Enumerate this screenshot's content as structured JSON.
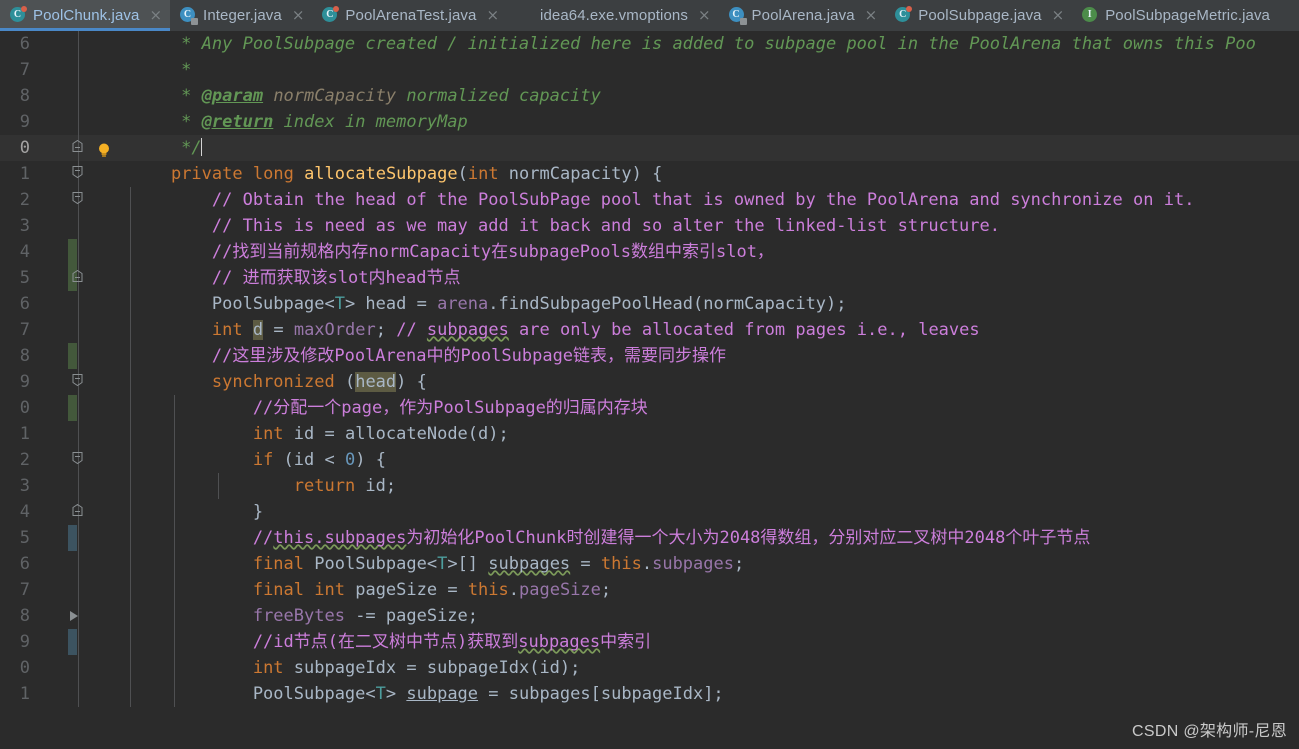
{
  "window": {
    "app": "IntelliJ IDEA",
    "theme_bg": "#2b2b2b",
    "accent": "#4a88c7"
  },
  "tabbar": {
    "tabs": [
      {
        "label": "PoolChunk.java",
        "icon": "java-class-icon",
        "icon_kind": "class-teal-dot",
        "active": true,
        "close": "×"
      },
      {
        "label": "Integer.java",
        "icon": "java-class-lock-icon",
        "icon_kind": "class-lock",
        "active": false,
        "close": "×"
      },
      {
        "label": "PoolArenaTest.java",
        "icon": "java-class-test-icon",
        "icon_kind": "class-teal-dot",
        "active": false,
        "close": "×"
      },
      {
        "label": "idea64.exe.vmoptions",
        "icon": "text-file-icon",
        "icon_kind": "file",
        "active": false,
        "close": "×"
      },
      {
        "label": "PoolArena.java",
        "icon": "java-class-abstract-icon",
        "icon_kind": "class-lock",
        "active": false,
        "close": "×"
      },
      {
        "label": "PoolSubpage.java",
        "icon": "java-class-icon",
        "icon_kind": "class-teal-dot",
        "active": false,
        "close": "×"
      },
      {
        "label": "PoolSubpageMetric.java",
        "icon": "java-interface-icon",
        "icon_kind": "interface",
        "active": false,
        "close": ""
      }
    ]
  },
  "editor": {
    "language": "Java",
    "lines": [
      {
        "num": "6",
        "vcs": "",
        "fold": "",
        "bulb": false,
        "current": false,
        "indents": [],
        "tokens": [
          {
            "t": "     * Any PoolSubpage created / initialized here is added to subpage pool in the PoolArena that owns this Poo",
            "c": "c-doc"
          }
        ]
      },
      {
        "num": "7",
        "vcs": "",
        "fold": "",
        "bulb": false,
        "current": false,
        "indents": [],
        "tokens": [
          {
            "t": "     *",
            "c": "c-doc"
          }
        ]
      },
      {
        "num": "8",
        "vcs": "",
        "fold": "",
        "bulb": false,
        "current": false,
        "indents": [],
        "tokens": [
          {
            "t": "     * ",
            "c": "c-doc"
          },
          {
            "t": "@param",
            "c": "c-doctag"
          },
          {
            "t": " normCapacity",
            "c": "c-docval"
          },
          {
            "t": " normalized capacity",
            "c": "c-doc"
          }
        ]
      },
      {
        "num": "9",
        "vcs": "",
        "fold": "",
        "bulb": false,
        "current": false,
        "indents": [],
        "tokens": [
          {
            "t": "     * ",
            "c": "c-doc"
          },
          {
            "t": "@return",
            "c": "c-doctag"
          },
          {
            "t": " index in memoryMap",
            "c": "c-doc"
          }
        ]
      },
      {
        "num": "0",
        "vcs": "",
        "fold": "end",
        "bulb": true,
        "current": true,
        "indents": [],
        "tokens": [
          {
            "t": "     */",
            "c": "c-doc"
          },
          {
            "t": "",
            "c": "caret"
          }
        ]
      },
      {
        "num": "1",
        "vcs": "",
        "fold": "start",
        "bulb": false,
        "current": false,
        "indents": [],
        "tokens": [
          {
            "t": "    ",
            "c": "c-punc"
          },
          {
            "t": "private",
            "c": "c-kw"
          },
          {
            "t": " ",
            "c": "c-punc"
          },
          {
            "t": "long",
            "c": "c-kw"
          },
          {
            "t": " ",
            "c": "c-punc"
          },
          {
            "t": "allocateSubpage",
            "c": "c-method"
          },
          {
            "t": "(",
            "c": "c-punc"
          },
          {
            "t": "int",
            "c": "c-kw"
          },
          {
            "t": " normCapacity) {",
            "c": "c-punc"
          }
        ]
      },
      {
        "num": "2",
        "vcs": "",
        "fold": "start",
        "bulb": false,
        "current": false,
        "indents": [
          130
        ],
        "tokens": [
          {
            "t": "        // Obtain the head of the PoolSubPage pool that is owned by the PoolArena and synchronize on it.",
            "c": "c-comment"
          }
        ]
      },
      {
        "num": "3",
        "vcs": "",
        "fold": "",
        "bulb": false,
        "current": false,
        "indents": [
          130
        ],
        "tokens": [
          {
            "t": "        // This is need as we may add it back and so alter the linked-list structure.",
            "c": "c-comment"
          }
        ]
      },
      {
        "num": "4",
        "vcs": "green",
        "fold": "",
        "bulb": false,
        "current": false,
        "indents": [
          130
        ],
        "tokens": [
          {
            "t": "        //找到当前规格内存normCapacity在subpagePools数组中索引slot，",
            "c": "c-comment"
          }
        ]
      },
      {
        "num": "5",
        "vcs": "green",
        "fold": "end",
        "bulb": false,
        "current": false,
        "indents": [
          130
        ],
        "tokens": [
          {
            "t": "        // 进而获取该slot内head节点",
            "c": "c-comment"
          }
        ]
      },
      {
        "num": "6",
        "vcs": "",
        "fold": "",
        "bulb": false,
        "current": false,
        "indents": [
          130
        ],
        "tokens": [
          {
            "t": "        PoolSubpage<",
            "c": "c-type"
          },
          {
            "t": "T",
            "c": "c-gen"
          },
          {
            "t": "> head = ",
            "c": "c-type"
          },
          {
            "t": "arena",
            "c": "c-field"
          },
          {
            "t": ".",
            "c": "c-punc"
          },
          {
            "t": "findSubpagePoolHead",
            "c": "c-ident"
          },
          {
            "t": "(normCapacity);",
            "c": "c-punc"
          }
        ]
      },
      {
        "num": "7",
        "vcs": "",
        "fold": "",
        "bulb": false,
        "current": false,
        "indents": [
          130
        ],
        "tokens": [
          {
            "t": "        ",
            "c": "c-punc"
          },
          {
            "t": "int",
            "c": "c-kw"
          },
          {
            "t": " ",
            "c": "c-punc"
          },
          {
            "t": "d",
            "c": "c-ident hl"
          },
          {
            "t": " = ",
            "c": "c-punc"
          },
          {
            "t": "maxOrder",
            "c": "c-field"
          },
          {
            "t": "; ",
            "c": "c-punc"
          },
          {
            "t": "// ",
            "c": "c-comment"
          },
          {
            "t": "subpages",
            "c": "c-comment warn"
          },
          {
            "t": " are only be allocated from pages i.e., leaves",
            "c": "c-comment"
          }
        ]
      },
      {
        "num": "8",
        "vcs": "green",
        "fold": "",
        "bulb": false,
        "current": false,
        "indents": [
          130
        ],
        "tokens": [
          {
            "t": "        //这里涉及修改PoolArena中的PoolSubpage链表，需要同步操作",
            "c": "c-comment"
          }
        ]
      },
      {
        "num": "9",
        "vcs": "",
        "fold": "start",
        "bulb": false,
        "current": false,
        "indents": [
          130
        ],
        "tokens": [
          {
            "t": "        ",
            "c": "c-punc"
          },
          {
            "t": "synchronized",
            "c": "c-kw"
          },
          {
            "t": " (",
            "c": "c-punc"
          },
          {
            "t": "head",
            "c": "c-ident hl"
          },
          {
            "t": ") {",
            "c": "c-punc"
          }
        ]
      },
      {
        "num": "0",
        "vcs": "green",
        "fold": "",
        "bulb": false,
        "current": false,
        "indents": [
          130,
          174
        ],
        "tokens": [
          {
            "t": "            //分配一个page，作为PoolSubpage的归属内存块",
            "c": "c-comment"
          }
        ]
      },
      {
        "num": "1",
        "vcs": "",
        "fold": "",
        "bulb": false,
        "current": false,
        "indents": [
          130,
          174
        ],
        "tokens": [
          {
            "t": "            ",
            "c": "c-punc"
          },
          {
            "t": "int",
            "c": "c-kw"
          },
          {
            "t": " id = ",
            "c": "c-punc"
          },
          {
            "t": "allocateNode",
            "c": "c-ident"
          },
          {
            "t": "(d);",
            "c": "c-punc"
          }
        ]
      },
      {
        "num": "2",
        "vcs": "",
        "fold": "start",
        "bulb": false,
        "current": false,
        "indents": [
          130,
          174
        ],
        "tokens": [
          {
            "t": "            ",
            "c": "c-punc"
          },
          {
            "t": "if",
            "c": "c-kw"
          },
          {
            "t": " (id < ",
            "c": "c-punc"
          },
          {
            "t": "0",
            "c": "c-num"
          },
          {
            "t": ") {",
            "c": "c-punc"
          }
        ]
      },
      {
        "num": "3",
        "vcs": "",
        "fold": "",
        "bulb": false,
        "current": false,
        "indents": [
          130,
          174,
          218
        ],
        "tokens": [
          {
            "t": "                ",
            "c": "c-punc"
          },
          {
            "t": "return",
            "c": "c-kw"
          },
          {
            "t": " id;",
            "c": "c-punc"
          }
        ]
      },
      {
        "num": "4",
        "vcs": "",
        "fold": "end",
        "bulb": false,
        "current": false,
        "indents": [
          130,
          174
        ],
        "tokens": [
          {
            "t": "            }",
            "c": "c-punc"
          }
        ]
      },
      {
        "num": "5",
        "vcs": "blue",
        "fold": "",
        "bulb": false,
        "current": false,
        "indents": [
          130,
          174
        ],
        "tokens": [
          {
            "t": "            //",
            "c": "c-comment"
          },
          {
            "t": "this.subpages",
            "c": "c-comment warn"
          },
          {
            "t": "为初始化PoolChunk时创建得一个大小为2048得数组，分别对应二叉树中2048个叶子节点",
            "c": "c-comment"
          }
        ]
      },
      {
        "num": "6",
        "vcs": "",
        "fold": "",
        "bulb": false,
        "current": false,
        "indents": [
          130,
          174
        ],
        "tokens": [
          {
            "t": "            ",
            "c": "c-punc"
          },
          {
            "t": "final",
            "c": "c-kw"
          },
          {
            "t": " PoolSubpage<",
            "c": "c-type"
          },
          {
            "t": "T",
            "c": "c-gen"
          },
          {
            "t": ">[] ",
            "c": "c-type"
          },
          {
            "t": "subpages",
            "c": "c-type warn"
          },
          {
            "t": " = ",
            "c": "c-punc"
          },
          {
            "t": "this",
            "c": "c-kw"
          },
          {
            "t": ".",
            "c": "c-punc"
          },
          {
            "t": "subpages",
            "c": "c-field"
          },
          {
            "t": ";",
            "c": "c-punc"
          }
        ]
      },
      {
        "num": "7",
        "vcs": "",
        "fold": "",
        "bulb": false,
        "current": false,
        "indents": [
          130,
          174
        ],
        "tokens": [
          {
            "t": "            ",
            "c": "c-punc"
          },
          {
            "t": "final",
            "c": "c-kw"
          },
          {
            "t": " ",
            "c": "c-punc"
          },
          {
            "t": "int",
            "c": "c-kw"
          },
          {
            "t": " pageSize = ",
            "c": "c-punc"
          },
          {
            "t": "this",
            "c": "c-kw"
          },
          {
            "t": ".",
            "c": "c-punc"
          },
          {
            "t": "pageSize",
            "c": "c-field"
          },
          {
            "t": ";",
            "c": "c-punc"
          }
        ]
      },
      {
        "num": "8",
        "vcs": "",
        "fold": "",
        "bulb": false,
        "current": false,
        "indents": [
          130,
          174
        ],
        "tokens": [
          {
            "t": "            ",
            "c": "c-punc"
          },
          {
            "t": "freeBytes",
            "c": "c-field"
          },
          {
            "t": " -= pageSize;",
            "c": "c-punc"
          }
        ]
      },
      {
        "num": "9",
        "vcs": "blue",
        "fold": "",
        "bulb": false,
        "current": false,
        "indents": [
          130,
          174
        ],
        "tokens": [
          {
            "t": "            //id节点(在二叉树中节点)获取到",
            "c": "c-comment"
          },
          {
            "t": "subpages",
            "c": "c-comment warn"
          },
          {
            "t": "中索引",
            "c": "c-comment"
          }
        ]
      },
      {
        "num": "0",
        "vcs": "",
        "fold": "",
        "bulb": false,
        "current": false,
        "indents": [
          130,
          174
        ],
        "tokens": [
          {
            "t": "            ",
            "c": "c-punc"
          },
          {
            "t": "int",
            "c": "c-kw"
          },
          {
            "t": " subpageIdx = ",
            "c": "c-punc"
          },
          {
            "t": "subpageIdx",
            "c": "c-ident"
          },
          {
            "t": "(id);",
            "c": "c-punc"
          }
        ]
      },
      {
        "num": "1",
        "vcs": "",
        "fold": "",
        "bulb": false,
        "current": false,
        "indents": [
          130,
          174
        ],
        "tokens": [
          {
            "t": "            PoolSubpage<",
            "c": "c-type"
          },
          {
            "t": "T",
            "c": "c-gen"
          },
          {
            "t": "> ",
            "c": "c-type"
          },
          {
            "t": "subpage",
            "c": "c-type under"
          },
          {
            "t": " = subpages[subpageIdx];",
            "c": "c-punc"
          }
        ]
      }
    ]
  },
  "watermark": {
    "text": "CSDN @架构师-尼恩"
  }
}
